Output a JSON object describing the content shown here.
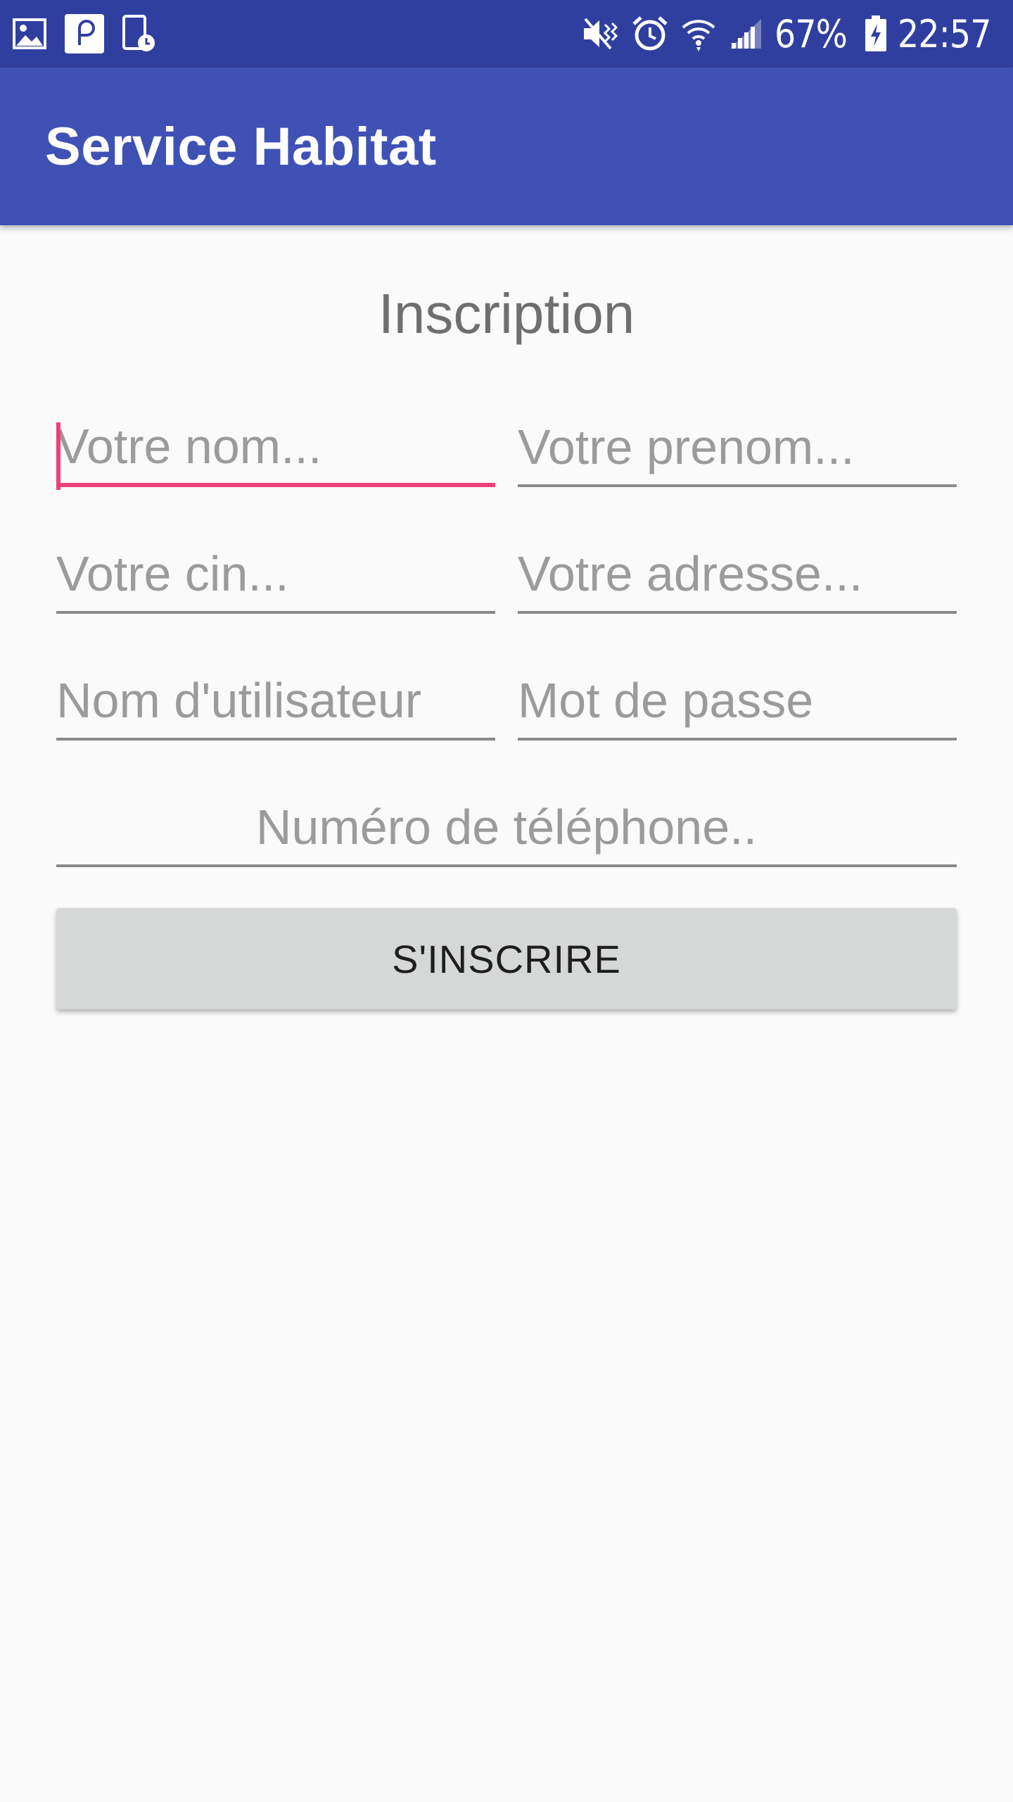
{
  "status_bar": {
    "left_icons": [
      "gallery-icon",
      "notification-app-icon",
      "screen-time-icon"
    ],
    "right_icons": [
      "mute-vibrate-icon",
      "alarm-icon",
      "wifi-icon",
      "signal-icon",
      "battery-charging-icon"
    ],
    "battery": "67%",
    "time": "22:57"
  },
  "app_bar": {
    "title": "Service Habitat"
  },
  "form": {
    "heading": "Inscription",
    "fields": {
      "nom": {
        "placeholder": "Votre nom...",
        "value": ""
      },
      "prenom": {
        "placeholder": "Votre prenom...",
        "value": ""
      },
      "cin": {
        "placeholder": "Votre cin...",
        "value": ""
      },
      "adresse": {
        "placeholder": "Votre adresse...",
        "value": ""
      },
      "username": {
        "placeholder": "Nom d'utilisateur",
        "value": ""
      },
      "password": {
        "placeholder": "Mot de passe",
        "value": ""
      },
      "telephone": {
        "placeholder": "Numéro de téléphone..",
        "value": ""
      }
    },
    "submit_label": "S'INSCRIRE"
  },
  "colors": {
    "status_bar": "#303f9f",
    "app_bar": "#3f51b5",
    "accent": "#ec407a",
    "button": "#d6d7d7",
    "background": "#fafafa"
  }
}
